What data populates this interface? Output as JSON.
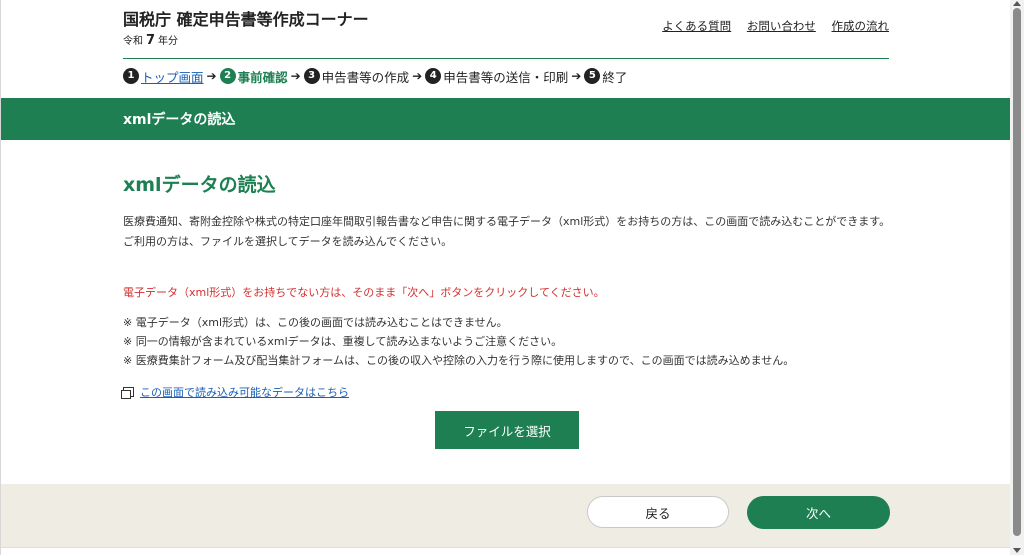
{
  "header": {
    "site_title": "国税庁 確定申告書等作成コーナー",
    "year_prefix": "令和",
    "year_number": "7",
    "year_suffix": "年分",
    "links": [
      "よくある質問",
      "お問い合わせ",
      "作成の流れ"
    ]
  },
  "steps": [
    {
      "num": "1",
      "label": "トップ画面"
    },
    {
      "num": "2",
      "label": "事前確認"
    },
    {
      "num": "3",
      "label": "申告書等の作成"
    },
    {
      "num": "4",
      "label": "申告書等の送信・印刷"
    },
    {
      "num": "5",
      "label": "終了"
    }
  ],
  "band_title": "xmlデータの読込",
  "main": {
    "heading": "xmlデータの読込",
    "intro_1": "医療費通知、寄附金控除や株式の特定口座年間取引報告書など申告に関する電子データ（xml形式）をお持ちの方は、この画面で読み込むことができます。",
    "intro_2": "ご利用の方は、ファイルを選択してデータを読み込んでください。",
    "red_note": "電子データ（xml形式）をお持ちでない方は、そのまま「次へ」ボタンをクリックしてください。",
    "notes": [
      "※  電子データ（xml形式）は、この後の画面では読み込むことはできません。",
      "※  同一の情報が含まれているxmlデータは、重複して読み込まないようご注意ください。",
      "※  医療費集計フォーム及び配当集計フォームは、この後の収入や控除の入力を行う際に使用しますので、この画面では読み込めません。"
    ],
    "ext_link": "この画面で読み込み可能なデータはこちら",
    "file_button": "ファイルを選択"
  },
  "footer": {
    "back": "戻る",
    "next": "次へ"
  },
  "colors": {
    "brand_green": "#1d7f52",
    "alert_red": "#d32f2f",
    "footer_bg": "#efede3"
  }
}
